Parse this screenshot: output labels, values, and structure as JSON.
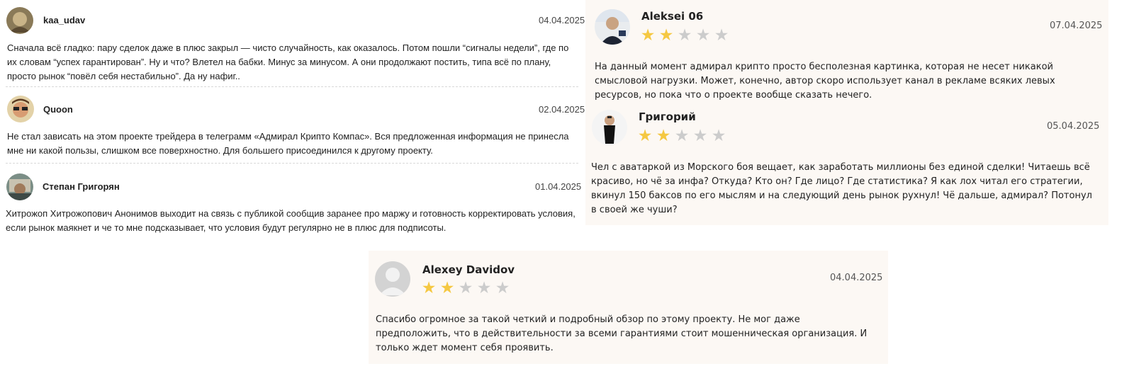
{
  "colors": {
    "star_filled": "#f5c842",
    "star_empty": "#cccccc",
    "card_bg": "#fcf8f4"
  },
  "left_reviews": [
    {
      "name": "kaa_udav",
      "date": "04.04.2025",
      "text": "Сначала всё гладко: пару сделок даже в плюс закрыл — чисто случайность, как оказалось. Потом пошли “сигналы недели”, где по их словам “успех гарантирован”. Ну и что? Влетел на бабки. Минус за минусом. А они продолжают постить, типа всё по плану, просто рынок “повёл себя нестабильно”. Да ну нафиг.."
    },
    {
      "name": "Quoon",
      "date": "02.04.2025",
      "text": "Не стал зависать на этом проекте трейдера в телеграмм «Адмирал Крипто Компас». Вся предложенная информация не принесла мне ни какой пользы, слишком все поверхностно. Для большего присоединился к другому проекту."
    },
    {
      "name": "Степан Григорян",
      "date": "01.04.2025",
      "text": "Хитрожоп Хитрожопович Анонимов выходит на связь с публикой сообщив заранее про маржу и готовность корректировать условия, если рынок маякнет и че то мне подсказывает, что условия будут регулярно не в плюс для подписоты."
    }
  ],
  "right_reviews": [
    {
      "name": "Aleksei 06",
      "date": "07.04.2025",
      "rating": 2,
      "max_rating": 5,
      "text": "На данный момент адмирал крипто просто бесполезная картинка, которая не несет никакой смысловой нагрузки. Может, конечно, автор скоро использует канал в рекламе всяких левых ресурсов, но пока что о проекте вообще сказать нечего."
    },
    {
      "name": "Григорий",
      "date": "05.04.2025",
      "rating": 2,
      "max_rating": 5,
      "text": "Чел с аватаркой из Морского боя вещает, как заработать миллионы без единой сделки! Читаешь всё красиво, но чё за инфа? Откуда? Кто он? Где лицо? Где статистика? Я как лох читал его стратегии, вкинул 150 баксов по его мыслям и на следующий день рынок рухнул! Чё дальше, адмирал? Потонул в своей же чуши?"
    }
  ],
  "bottom_review": {
    "name": "Alexey Davidov",
    "date": "04.04.2025",
    "rating": 2,
    "max_rating": 5,
    "text": "Спасибо огромное за такой четкий и подробный обзор по этому проекту. Не мог даже предположить, что в действительности за всеми гарантиями стоит мошенническая организация. И только ждет момент себя проявить."
  }
}
